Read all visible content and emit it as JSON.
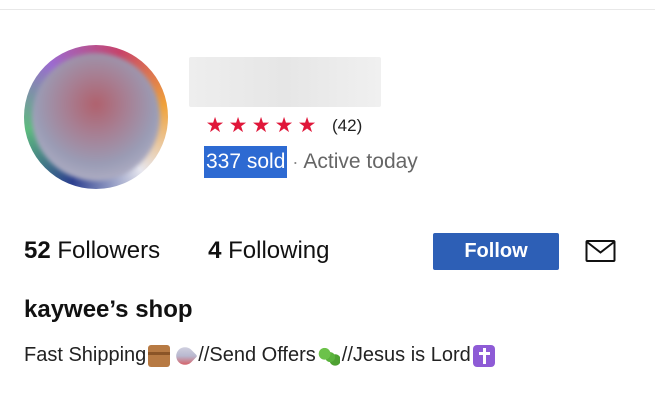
{
  "profile": {
    "rating": {
      "stars": 5,
      "star_glyph": "★",
      "count": "(42)",
      "star_color": "#e0173a"
    },
    "sold": "337 sold",
    "separator": "·",
    "activity": "Active today"
  },
  "stats": {
    "followers_count": "52",
    "followers_label": "Followers",
    "following_count": "4",
    "following_label": "Following"
  },
  "actions": {
    "follow_label": "Follow",
    "follow_color": "#2d5fb6",
    "message_icon": "envelope-icon"
  },
  "shop": {
    "name": "kaywee’s shop",
    "bio": {
      "part1": "Fast Shipping",
      "emoji1": "package-emoji",
      "emoji2": "rocket-emoji",
      "part2": "//Send Offers",
      "emoji3": "caterpillar-emoji",
      "part3": "//Jesus is Lord",
      "emoji4": "cross-emoji"
    }
  }
}
